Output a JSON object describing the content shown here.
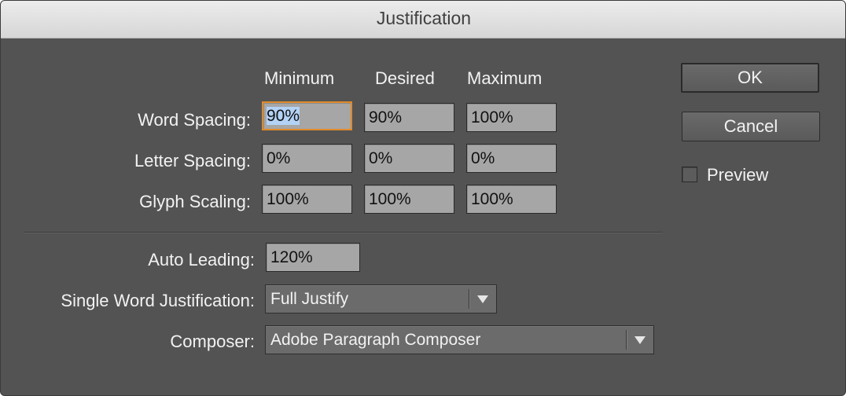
{
  "dialog": {
    "title": "Justification"
  },
  "columns": {
    "minimum": "Minimum",
    "desired": "Desired",
    "maximum": "Maximum"
  },
  "rows": {
    "word_spacing": {
      "label": "Word Spacing:",
      "minimum": "90%",
      "desired": "90%",
      "maximum": "100%"
    },
    "letter_spacing": {
      "label": "Letter Spacing:",
      "minimum": "0%",
      "desired": "0%",
      "maximum": "0%"
    },
    "glyph_scaling": {
      "label": "Glyph Scaling:",
      "minimum": "100%",
      "desired": "100%",
      "maximum": "100%"
    }
  },
  "auto_leading": {
    "label": "Auto Leading:",
    "value": "120%"
  },
  "single_word_justification": {
    "label": "Single Word Justification:",
    "value": "Full Justify"
  },
  "composer": {
    "label": "Composer:",
    "value": "Adobe Paragraph Composer"
  },
  "buttons": {
    "ok": "OK",
    "cancel": "Cancel"
  },
  "preview": {
    "label": "Preview",
    "checked": false
  },
  "colors": {
    "panel": "#535353",
    "field": "#a6a6a6",
    "focus": "#e08a2c",
    "selection": "#b3d2f5"
  }
}
